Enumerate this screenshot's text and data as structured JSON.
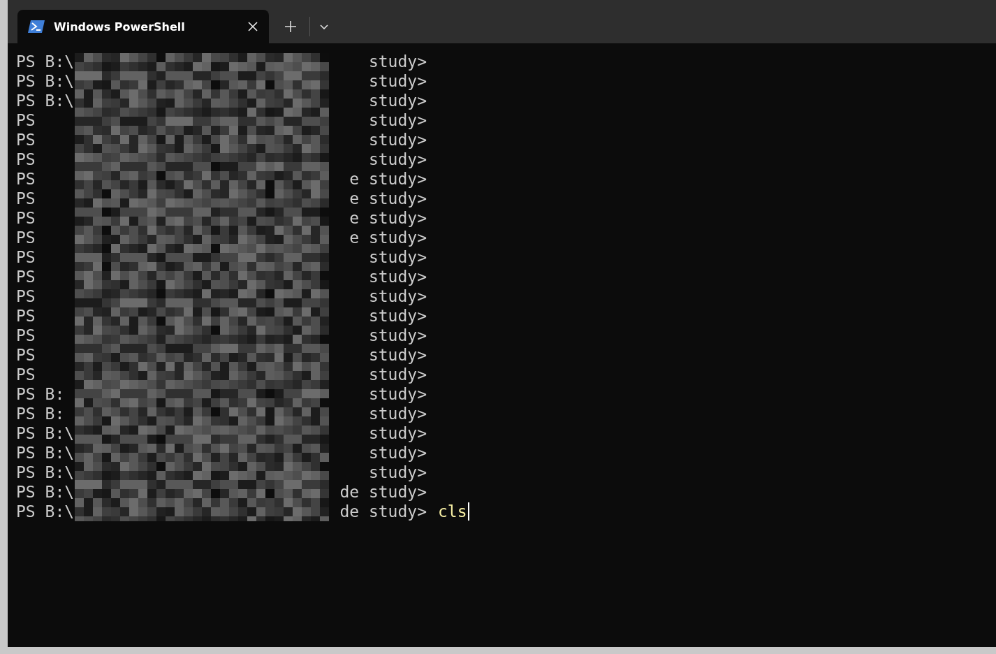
{
  "tabs": [
    {
      "title": "Windows PowerShell",
      "selected": true
    }
  ],
  "terminal": {
    "cursor": true,
    "lines": [
      {
        "prompt": "PS B:\\",
        "tail": "study>"
      },
      {
        "prompt": "PS B:\\",
        "tail": "study>"
      },
      {
        "prompt": "PS B:\\",
        "tail": "study>"
      },
      {
        "prompt": "PS",
        "tail": "study>"
      },
      {
        "prompt": "PS",
        "tail": "study>"
      },
      {
        "prompt": "PS",
        "tail": "study>"
      },
      {
        "prompt": "PS",
        "tail": "e study>"
      },
      {
        "prompt": "PS",
        "tail": "e study>"
      },
      {
        "prompt": "PS",
        "tail": "e study>"
      },
      {
        "prompt": "PS",
        "tail": "e study>"
      },
      {
        "prompt": "PS",
        "tail": "study>"
      },
      {
        "prompt": "PS",
        "tail": "study>"
      },
      {
        "prompt": "PS",
        "tail": "study>"
      },
      {
        "prompt": "PS",
        "tail": "study>"
      },
      {
        "prompt": "PS",
        "tail": "study>"
      },
      {
        "prompt": "PS",
        "tail": "study>"
      },
      {
        "prompt": "PS",
        "tail": "study>"
      },
      {
        "prompt": "PS B:",
        "tail": "study>"
      },
      {
        "prompt": "PS B:",
        "tail": "study>"
      },
      {
        "prompt": "PS B:\\",
        "tail": "study>"
      },
      {
        "prompt": "PS B:\\",
        "tail": "study>"
      },
      {
        "prompt": "PS B:\\",
        "tail": "study>"
      },
      {
        "prompt": "PS B:\\",
        "tail": "de study>"
      },
      {
        "prompt": "PS B:\\",
        "tail": "de study>",
        "command": "cls"
      }
    ]
  }
}
